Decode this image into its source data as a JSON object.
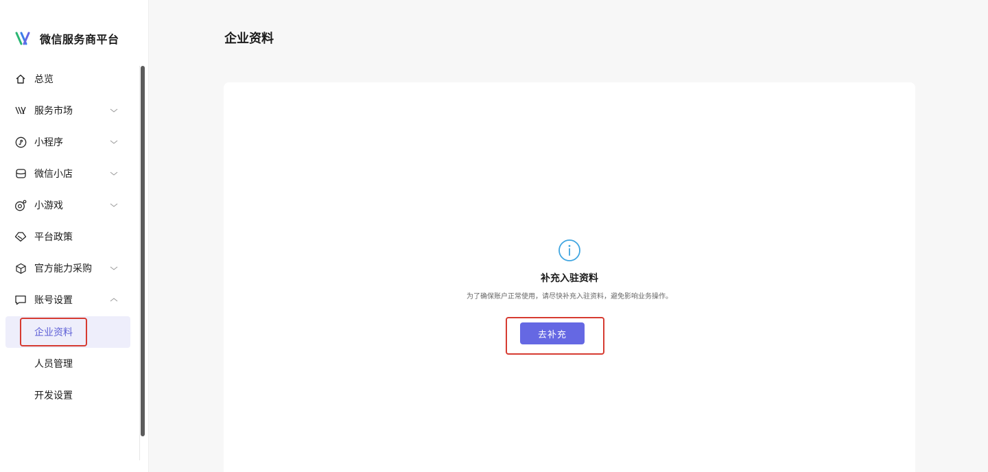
{
  "brand": {
    "name": "微信服务商平台"
  },
  "sidebar": {
    "items": [
      {
        "label": "总览",
        "icon": "home-icon"
      },
      {
        "label": "服务市场",
        "icon": "service-market-icon",
        "expandable": true
      },
      {
        "label": "小程序",
        "icon": "mini-program-icon",
        "expandable": true
      },
      {
        "label": "微信小店",
        "icon": "shop-icon",
        "expandable": true
      },
      {
        "label": "小游戏",
        "icon": "game-icon",
        "expandable": true
      },
      {
        "label": "平台政策",
        "icon": "policy-icon"
      },
      {
        "label": "官方能力采购",
        "icon": "box-icon",
        "expandable": true
      },
      {
        "label": "账号设置",
        "icon": "account-icon",
        "expandable": true,
        "expanded": true
      }
    ],
    "sub_items": [
      {
        "label": "企业资料",
        "active": true
      },
      {
        "label": "人员管理"
      },
      {
        "label": "开发设置"
      }
    ]
  },
  "main": {
    "title": "企业资料",
    "notice": {
      "title": "补充入驻资料",
      "description": "为了确保账户正常使用，请尽快补充入驻资料，避免影响业务操作。",
      "button": "去补充"
    }
  },
  "colors": {
    "accent": "#6568e3",
    "active_bg": "#eeeefb",
    "highlight": "#d63a30",
    "info": "#3fa5e0"
  }
}
